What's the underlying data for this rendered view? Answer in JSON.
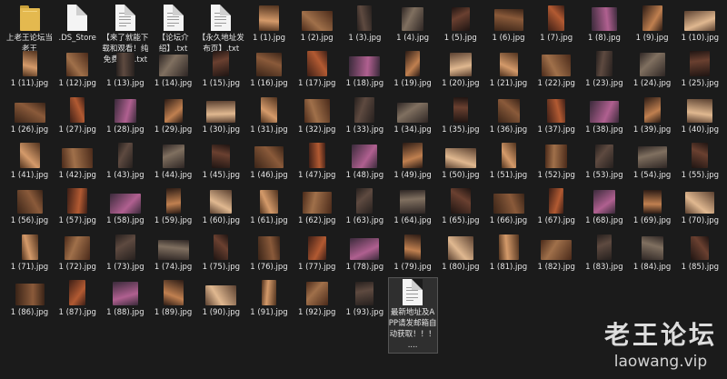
{
  "files": [
    {
      "label": "上老王论坛当老王",
      "kind": "folder"
    },
    {
      "label": ".DS_Store",
      "kind": "file"
    },
    {
      "label": "【来了就能下载和观看！纯免费！】.txt",
      "kind": "text"
    },
    {
      "label": "【论坛介绍】.txt",
      "kind": "text"
    },
    {
      "label": "【永久地址发布页】.txt",
      "kind": "text"
    },
    {
      "label": "1 (1).jpg",
      "kind": "image"
    },
    {
      "label": "1 (2).jpg",
      "kind": "image"
    },
    {
      "label": "1 (3).jpg",
      "kind": "image"
    },
    {
      "label": "1 (4).jpg",
      "kind": "image"
    },
    {
      "label": "1 (5).jpg",
      "kind": "image"
    },
    {
      "label": "1 (6).jpg",
      "kind": "image"
    },
    {
      "label": "1 (7).jpg",
      "kind": "image"
    },
    {
      "label": "1 (8).jpg",
      "kind": "image"
    },
    {
      "label": "1 (9).jpg",
      "kind": "image"
    },
    {
      "label": "1 (10).jpg",
      "kind": "image"
    },
    {
      "label": "1 (11).jpg",
      "kind": "image"
    },
    {
      "label": "1 (12).jpg",
      "kind": "image"
    },
    {
      "label": "1 (13).jpg",
      "kind": "image"
    },
    {
      "label": "1 (14).jpg",
      "kind": "image"
    },
    {
      "label": "1 (15).jpg",
      "kind": "image"
    },
    {
      "label": "1 (16).jpg",
      "kind": "image"
    },
    {
      "label": "1 (17).jpg",
      "kind": "image"
    },
    {
      "label": "1 (18).jpg",
      "kind": "image"
    },
    {
      "label": "1 (19).jpg",
      "kind": "image"
    },
    {
      "label": "1 (20).jpg",
      "kind": "image"
    },
    {
      "label": "1 (21).jpg",
      "kind": "image"
    },
    {
      "label": "1 (22).jpg",
      "kind": "image"
    },
    {
      "label": "1 (23).jpg",
      "kind": "image"
    },
    {
      "label": "1 (24).jpg",
      "kind": "image"
    },
    {
      "label": "1 (25).jpg",
      "kind": "image"
    },
    {
      "label": "1 (26).jpg",
      "kind": "image"
    },
    {
      "label": "1 (27).jpg",
      "kind": "image"
    },
    {
      "label": "1 (28).jpg",
      "kind": "image"
    },
    {
      "label": "1 (29).jpg",
      "kind": "image"
    },
    {
      "label": "1 (30).jpg",
      "kind": "image"
    },
    {
      "label": "1 (31).jpg",
      "kind": "image"
    },
    {
      "label": "1 (32).jpg",
      "kind": "image"
    },
    {
      "label": "1 (33).jpg",
      "kind": "image"
    },
    {
      "label": "1 (34).jpg",
      "kind": "image"
    },
    {
      "label": "1 (35).jpg",
      "kind": "image"
    },
    {
      "label": "1 (36).jpg",
      "kind": "image"
    },
    {
      "label": "1 (37).jpg",
      "kind": "image"
    },
    {
      "label": "1 (38).jpg",
      "kind": "image"
    },
    {
      "label": "1 (39).jpg",
      "kind": "image"
    },
    {
      "label": "1 (40).jpg",
      "kind": "image"
    },
    {
      "label": "1 (41).jpg",
      "kind": "image"
    },
    {
      "label": "1 (42).jpg",
      "kind": "image"
    },
    {
      "label": "1 (43).jpg",
      "kind": "image"
    },
    {
      "label": "1 (44).jpg",
      "kind": "image"
    },
    {
      "label": "1 (45).jpg",
      "kind": "image"
    },
    {
      "label": "1 (46).jpg",
      "kind": "image"
    },
    {
      "label": "1 (47).jpg",
      "kind": "image"
    },
    {
      "label": "1 (48).jpg",
      "kind": "image"
    },
    {
      "label": "1 (49).jpg",
      "kind": "image"
    },
    {
      "label": "1 (50).jpg",
      "kind": "image"
    },
    {
      "label": "1 (51).jpg",
      "kind": "image"
    },
    {
      "label": "1 (52).jpg",
      "kind": "image"
    },
    {
      "label": "1 (53).jpg",
      "kind": "image"
    },
    {
      "label": "1 (54).jpg",
      "kind": "image"
    },
    {
      "label": "1 (55).jpg",
      "kind": "image"
    },
    {
      "label": "1 (56).jpg",
      "kind": "image"
    },
    {
      "label": "1 (57).jpg",
      "kind": "image"
    },
    {
      "label": "1 (58).jpg",
      "kind": "image"
    },
    {
      "label": "1 (59).jpg",
      "kind": "image"
    },
    {
      "label": "1 (60).jpg",
      "kind": "image"
    },
    {
      "label": "1 (61).jpg",
      "kind": "image"
    },
    {
      "label": "1 (62).jpg",
      "kind": "image"
    },
    {
      "label": "1 (63).jpg",
      "kind": "image"
    },
    {
      "label": "1 (64).jpg",
      "kind": "image"
    },
    {
      "label": "1 (65).jpg",
      "kind": "image"
    },
    {
      "label": "1 (66).jpg",
      "kind": "image"
    },
    {
      "label": "1 (67).jpg",
      "kind": "image"
    },
    {
      "label": "1 (68).jpg",
      "kind": "image"
    },
    {
      "label": "1 (69).jpg",
      "kind": "image"
    },
    {
      "label": "1 (70).jpg",
      "kind": "image"
    },
    {
      "label": "1 (71).jpg",
      "kind": "image"
    },
    {
      "label": "1 (72).jpg",
      "kind": "image"
    },
    {
      "label": "1 (73).jpg",
      "kind": "image"
    },
    {
      "label": "1 (74).jpg",
      "kind": "image"
    },
    {
      "label": "1 (75).jpg",
      "kind": "image"
    },
    {
      "label": "1 (76).jpg",
      "kind": "image"
    },
    {
      "label": "1 (77).jpg",
      "kind": "image"
    },
    {
      "label": "1 (78).jpg",
      "kind": "image"
    },
    {
      "label": "1 (79).jpg",
      "kind": "image"
    },
    {
      "label": "1 (80).jpg",
      "kind": "image"
    },
    {
      "label": "1 (81).jpg",
      "kind": "image"
    },
    {
      "label": "1 (82).jpg",
      "kind": "image"
    },
    {
      "label": "1 (83).jpg",
      "kind": "image"
    },
    {
      "label": "1 (84).jpg",
      "kind": "image"
    },
    {
      "label": "1 (85).jpg",
      "kind": "image"
    },
    {
      "label": "1 (86).jpg",
      "kind": "image"
    },
    {
      "label": "1 (87).jpg",
      "kind": "image"
    },
    {
      "label": "1 (88).jpg",
      "kind": "image"
    },
    {
      "label": "1 (89).jpg",
      "kind": "image"
    },
    {
      "label": "1 (90).jpg",
      "kind": "image"
    },
    {
      "label": "1 (91).jpg",
      "kind": "image"
    },
    {
      "label": "1 (92).jpg",
      "kind": "image"
    },
    {
      "label": "1 (93).jpg",
      "kind": "image"
    },
    {
      "label": "最新地址及APP请发邮箱自动获取！！！ ....",
      "kind": "text",
      "selected": true
    }
  ],
  "watermark": {
    "title": "老王论坛",
    "url": "laowang.vip"
  },
  "colors": {
    "background": "#1b1b1b",
    "label": "#e6e6e6",
    "folder": "#e4b94f",
    "selection": "#2f2f2f"
  }
}
